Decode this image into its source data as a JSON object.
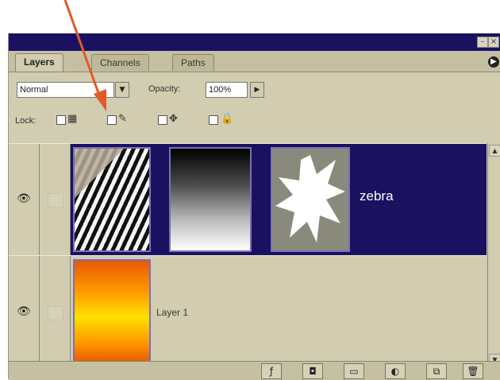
{
  "tabs": [
    {
      "label": "Layers",
      "active": true
    },
    {
      "label": "Channels",
      "active": false
    },
    {
      "label": "Paths",
      "active": false
    }
  ],
  "blend_mode": {
    "value": "Normal"
  },
  "opacity": {
    "label": "Opacity:",
    "value": "100%"
  },
  "lock": {
    "label": "Lock:"
  },
  "layers": [
    {
      "name": "zebra",
      "selected": true,
      "visible": true
    },
    {
      "name": "Layer 1",
      "selected": false,
      "visible": true
    }
  ],
  "icons": {
    "eye": "eye-icon",
    "brush": "brush-icon",
    "move": "move-icon",
    "lock": "lock-icon"
  },
  "colors": {
    "panel_bg": "#d2cdb0",
    "selection": "#1a1260",
    "annotation_arrow": "#e05a2a"
  }
}
